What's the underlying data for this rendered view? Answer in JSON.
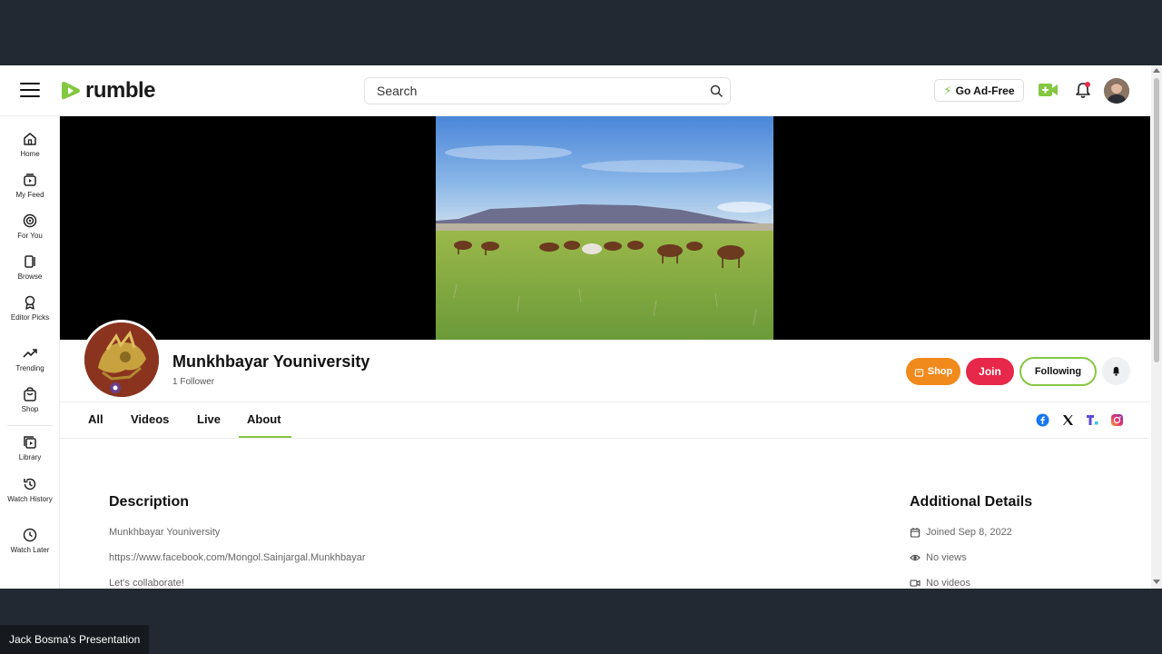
{
  "header": {
    "logo_text": "rumble",
    "search_placeholder": "Search",
    "ad_free_label": "Go Ad-Free",
    "brand_color": "#85c742"
  },
  "sidebar": {
    "items": [
      {
        "label": "Home",
        "icon": "home-icon"
      },
      {
        "label": "My Feed",
        "icon": "feed-icon"
      },
      {
        "label": "For You",
        "icon": "target-icon"
      },
      {
        "label": "Browse",
        "icon": "browse-icon"
      },
      {
        "label": "Editor Picks",
        "icon": "award-icon"
      },
      {
        "label": "Trending",
        "icon": "trending-icon"
      },
      {
        "label": "Shop",
        "icon": "shop-icon"
      },
      {
        "label": "Library",
        "icon": "library-icon"
      },
      {
        "label": "Watch History",
        "icon": "history-icon"
      },
      {
        "label": "Watch Later",
        "icon": "clock-icon"
      }
    ]
  },
  "channel": {
    "name": "Munkhbayar Youniversity",
    "followers": "1 Follower",
    "shop_label": "Shop",
    "join_label": "Join",
    "following_label": "Following",
    "shop_color": "#f08a1c",
    "join_color": "#e8284a"
  },
  "tabs": [
    {
      "label": "All"
    },
    {
      "label": "Videos"
    },
    {
      "label": "Live"
    },
    {
      "label": "About",
      "active": true
    }
  ],
  "about": {
    "description_heading": "Description",
    "description_lines": [
      "Munkhbayar Youniversity",
      "https://www.facebook.com/Mongol.Sainjargal.Munkhbayar",
      "Let's collaborate!"
    ],
    "details_heading": "Additional Details",
    "joined": "Joined Sep 8, 2022",
    "views": "No views",
    "videos": "No videos"
  },
  "presentation_caption": "Jack Bosma's Presentation"
}
